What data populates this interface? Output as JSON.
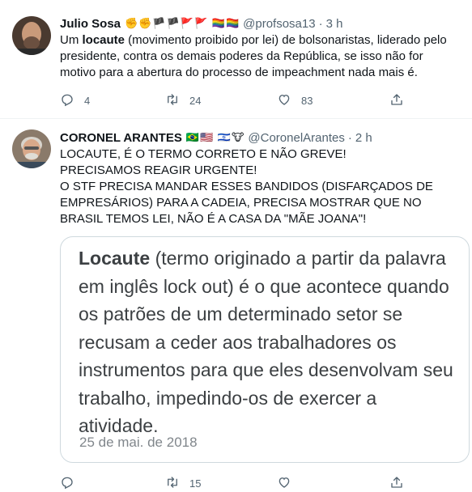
{
  "tweets": [
    {
      "name": "Julio Sosa",
      "emojis": "✊✊🏴🏴🚩🚩 🏳️‍🌈🏳️‍🌈",
      "handle": "@profsosa13",
      "separator": "·",
      "time": "3 h",
      "text_parts": [
        "Um ",
        "locaute",
        " (movimento proibido por lei) de bolsonaristas, liderado pelo presidente, contra os demais poderes da República, se isso não for motivo para a abertura do processo de impeachment nada mais é."
      ],
      "replies": "4",
      "retweets": "24",
      "likes": "83"
    },
    {
      "name": "CORONEL ARANTES",
      "emojis": "🇧🇷🇺🇸 🇮🇱🐮",
      "handle": "@CoronelArantes",
      "separator": "·",
      "time": "2 h",
      "text_lines": [
        "LOCAUTE, É O TERMO CORRETO E NÃO GREVE!",
        "PRECISAMOS REAGIR URGENTE!",
        "O STF PRECISA MANDAR ESSES BANDIDOS (DISFARÇADOS DE EMPRESÁRIOS) PARA A CADEIA, PRECISA MOSTRAR QUE NO BRASIL TEMOS LEI, NÃO É A CASA DA \"MÃE JOANA\"!"
      ],
      "quote": {
        "term": "Locaute",
        "definition": " (termo originado a partir da palavra em inglês lock out) é o que acontece quando os patrões de um determinado setor se recusam a ceder aos trabalhadores os instrumentos para que eles desenvolvam seu trabalho, impedindo-os de exercer a atividade.",
        "date": "25 de mai. de 2018"
      },
      "partial_count": "15"
    }
  ],
  "icons": {
    "reply": "reply-icon",
    "retweet": "retweet-icon",
    "like": "heart-icon",
    "share": "share-icon"
  },
  "colors": {
    "text": "#0f1419",
    "muted": "#536471",
    "border": "#cfd9de",
    "divider": "#eff3f4"
  }
}
